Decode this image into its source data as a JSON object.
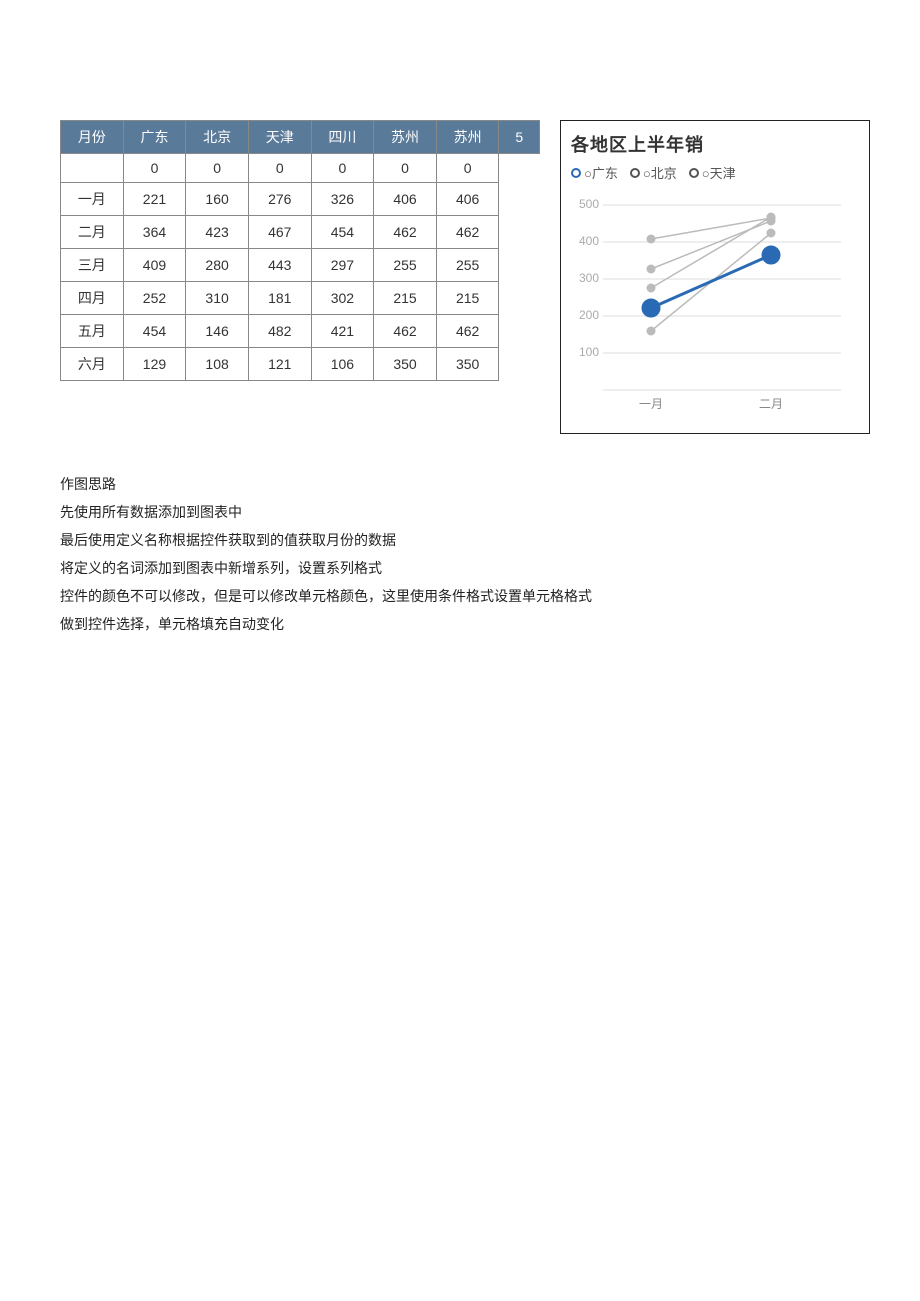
{
  "table": {
    "headers": [
      "月份",
      "广东",
      "北京",
      "天津",
      "四川",
      "苏州",
      "苏州",
      "5"
    ],
    "rows": [
      [
        "",
        "0",
        "0",
        "0",
        "0",
        "0",
        "0"
      ],
      [
        "一月",
        "221",
        "160",
        "276",
        "326",
        "406",
        "406"
      ],
      [
        "二月",
        "364",
        "423",
        "467",
        "454",
        "462",
        "462"
      ],
      [
        "三月",
        "409",
        "280",
        "443",
        "297",
        "255",
        "255"
      ],
      [
        "四月",
        "252",
        "310",
        "181",
        "302",
        "215",
        "215"
      ],
      [
        "五月",
        "454",
        "146",
        "482",
        "421",
        "462",
        "462"
      ],
      [
        "六月",
        "129",
        "108",
        "121",
        "106",
        "350",
        "350"
      ]
    ]
  },
  "chart": {
    "title": "各地区上半年销",
    "legend": [
      "广东",
      "北京",
      "天津"
    ],
    "y_labels": [
      "500",
      "400",
      "300",
      "200",
      "100"
    ],
    "x_labels": [
      "一月",
      "二月"
    ],
    "series": {
      "guangdong": [
        221,
        364
      ],
      "beijing": [
        160,
        423
      ],
      "tianjin": [
        276,
        467
      ],
      "sichuan": [
        326,
        454
      ],
      "suzhou1": [
        406,
        462
      ],
      "suzhou2": [
        406,
        462
      ]
    }
  },
  "notes": [
    "作图思路",
    "先使用所有数据添加到图表中",
    "最后使用定义名称根据控件获取到的值获取月份的数据",
    "将定义的名词添加到图表中新增系列，设置系列格式",
    "控件的颜色不可以修改，但是可以修改单元格颜色，这里使用条件格式设置单元格格式",
    "做到控件选择，单元格填充自动变化"
  ]
}
